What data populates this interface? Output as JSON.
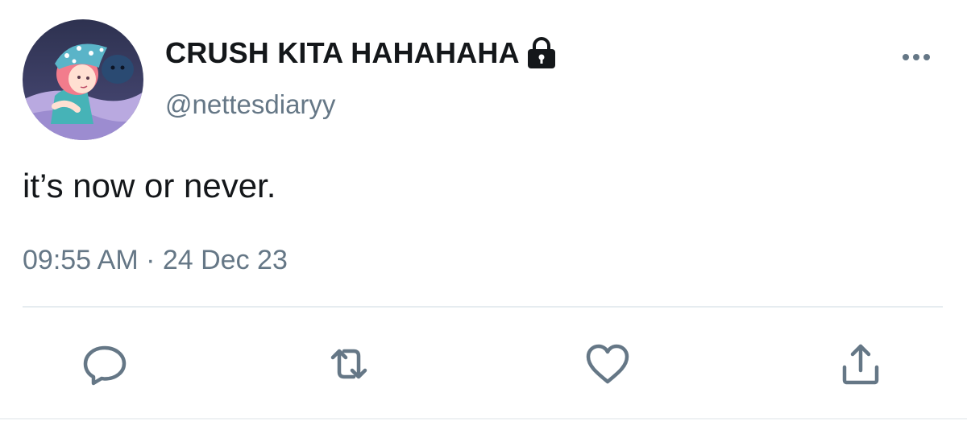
{
  "tweet": {
    "author": {
      "display_name": "CRUSH KITA HAHAHAHA",
      "handle": "@nettesdiaryy",
      "protected_icon": "lock-icon",
      "avatar": "anime-avatar"
    },
    "text": "it’s now or never.",
    "timestamp": "09:55 AM · 24 Dec 23",
    "more_icon": "more-horizontal-icon",
    "actions": [
      {
        "name": "reply",
        "icon": "reply-icon"
      },
      {
        "name": "retweet",
        "icon": "retweet-icon"
      },
      {
        "name": "like",
        "icon": "heart-icon"
      },
      {
        "name": "share",
        "icon": "share-icon"
      }
    ]
  },
  "colors": {
    "text_primary": "#14171a",
    "text_secondary": "#657786",
    "divider": "#e6ecf0",
    "background": "#ffffff"
  }
}
